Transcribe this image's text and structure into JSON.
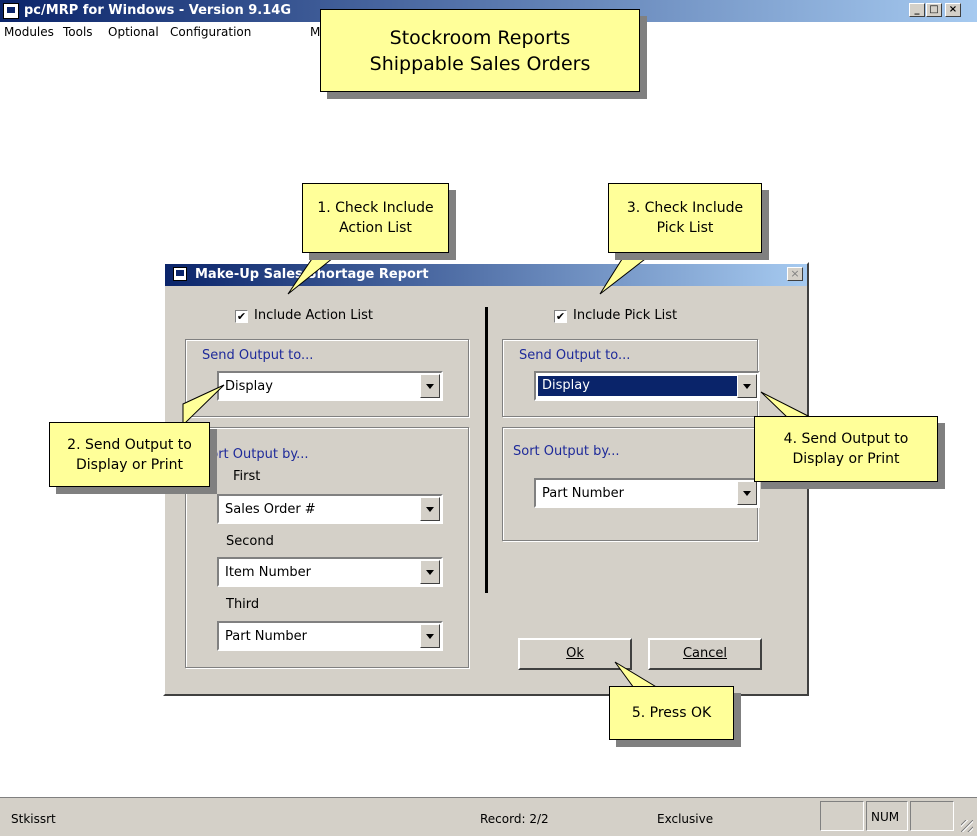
{
  "app": {
    "title": "pc/MRP for Windows - Version 9.14G",
    "minimize_glyph": "_",
    "maximize_glyph": "□",
    "close_glyph": "×"
  },
  "menu": [
    "Modules",
    "Tools",
    "Optional",
    "Configuration",
    "M"
  ],
  "header_callout": "Stockroom Reports\nShippable Sales Orders",
  "dialog": {
    "title": "Make-Up Sales Shortage Report",
    "close_glyph": "×",
    "left": {
      "include_label": "Include Action List",
      "include_checked": true,
      "send_output_title": "Send Output to...",
      "send_output_value": "Display",
      "sort_title": "Sort Output by...",
      "first_label": "First",
      "first_value": "Sales Order #",
      "second_label": "Second",
      "second_value": "Item Number",
      "third_label": "Third",
      "third_value": "Part Number"
    },
    "right": {
      "include_label": "Include Pick List",
      "include_checked": true,
      "send_output_title": "Send Output to...",
      "send_output_value": "Display",
      "sort_title": "Sort Output by...",
      "sort_value": "Part Number"
    },
    "ok_label": "Ok",
    "cancel_label": "Cancel"
  },
  "callouts": {
    "c1": "1. Check Include\nAction List",
    "c2": "2. Send Output to\nDisplay or Print",
    "c3": "3. Check Include\nPick List",
    "c4": "4. Send Output to\nDisplay or Print",
    "c5": "5. Press OK"
  },
  "status": {
    "program": "Stkissrt",
    "record": "Record: 2/2",
    "mode": "Exclusive",
    "num": "NUM"
  },
  "checkmark_glyph": "✔"
}
